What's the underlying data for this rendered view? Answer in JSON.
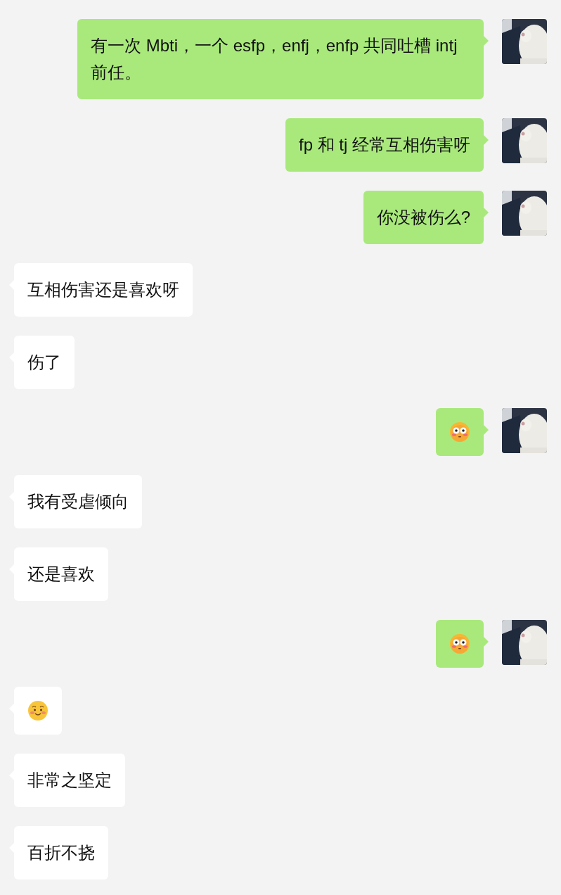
{
  "messages": [
    {
      "outgoing": true,
      "kind": "text",
      "text": "有一次 Mbti，一个 esfp，enfj，enfp 共同吐槽 intj 前任。"
    },
    {
      "outgoing": true,
      "kind": "text",
      "text": "fp 和 tj 经常互相伤害呀"
    },
    {
      "outgoing": true,
      "kind": "text",
      "text": "你没被伤么?"
    },
    {
      "outgoing": false,
      "kind": "text",
      "text": "互相伤害还是喜欢呀"
    },
    {
      "outgoing": false,
      "kind": "text",
      "text": "伤了"
    },
    {
      "outgoing": true,
      "kind": "flushed"
    },
    {
      "outgoing": false,
      "kind": "text",
      "text": "我有受虐倾向"
    },
    {
      "outgoing": false,
      "kind": "text",
      "text": "还是喜欢"
    },
    {
      "outgoing": true,
      "kind": "flushed"
    },
    {
      "outgoing": false,
      "kind": "blush"
    },
    {
      "outgoing": false,
      "kind": "text",
      "text": "非常之坚定"
    },
    {
      "outgoing": false,
      "kind": "text",
      "text": "百折不挠"
    }
  ]
}
